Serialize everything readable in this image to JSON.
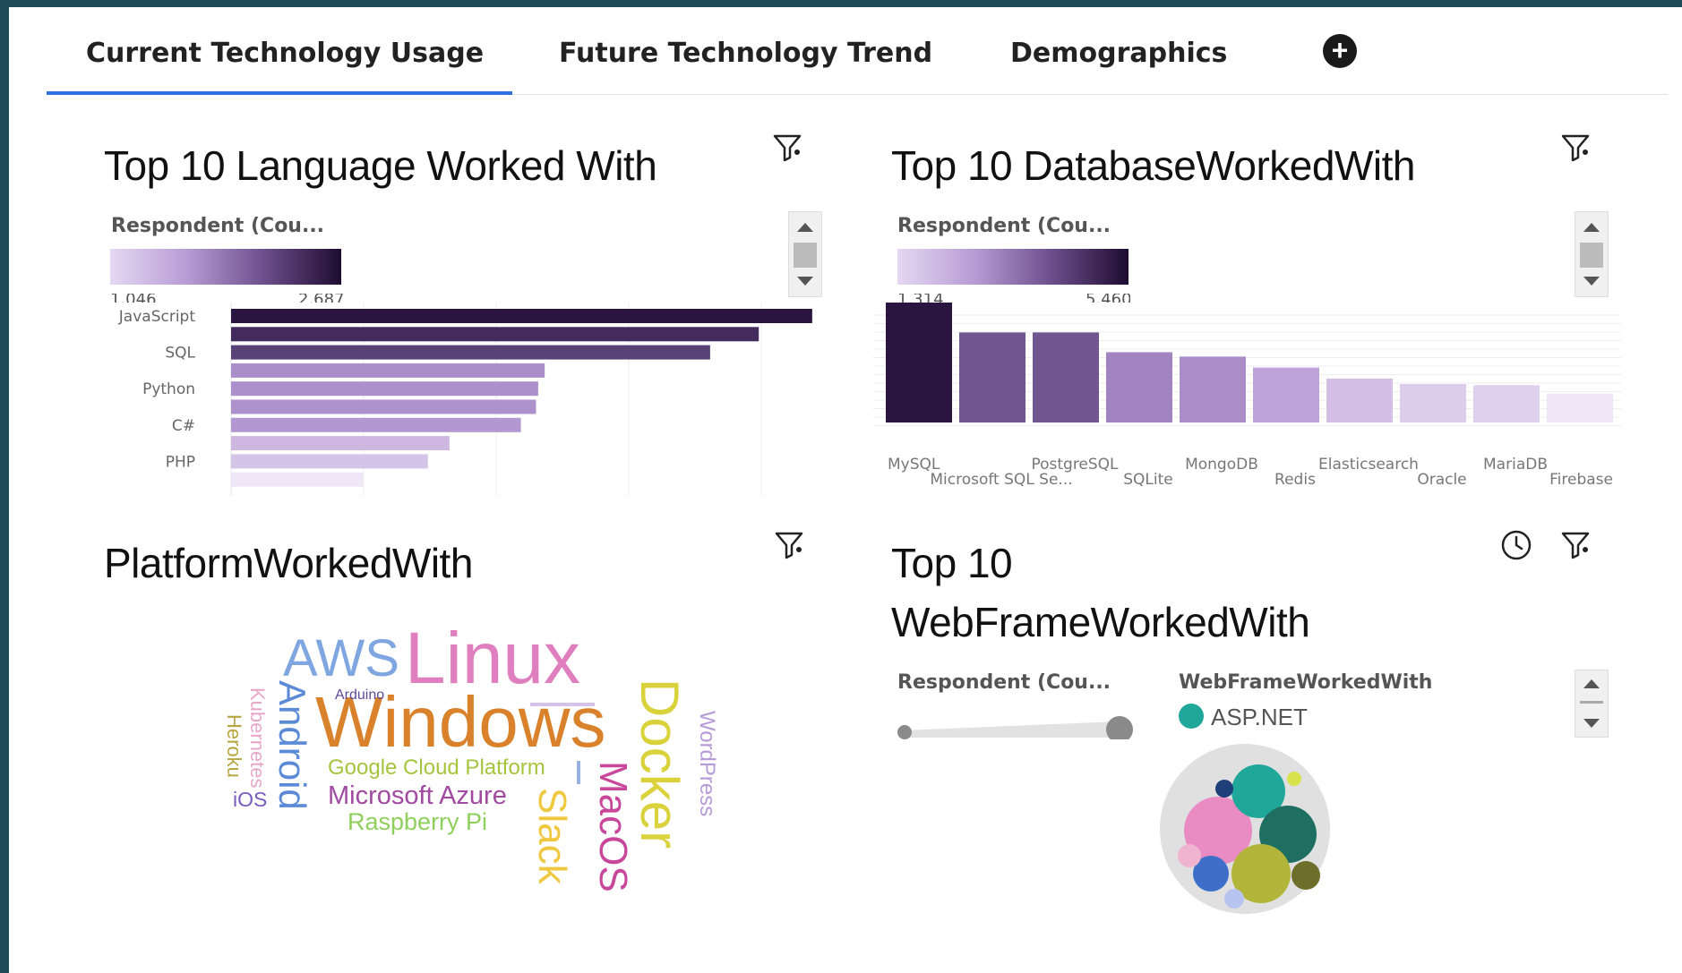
{
  "tabs": [
    {
      "label": "Current Technology Usage",
      "active": true
    },
    {
      "label": "Future Technology Trend",
      "active": false
    },
    {
      "label": "Demographics",
      "active": false
    }
  ],
  "add_tab_icon": "plus-circle-icon",
  "panels": {
    "languages": {
      "title": "Top 10 Language Worked With",
      "legend_label": "Respondent (Cou...",
      "legend_min": "1,046",
      "legend_max": "2,687"
    },
    "databases": {
      "title": "Top 10 DatabaseWorkedWith",
      "legend_label": "Respondent (Cou...",
      "legend_min": "1,314",
      "legend_max": "5,460"
    },
    "platforms": {
      "title": "PlatformWorkedWith"
    },
    "webframes": {
      "title_line1": "Top 10",
      "title_line2": "WebFrameWorkedWith",
      "legend_label": "Respondent (Cou...",
      "legend2_label": "WebFrameWorkedWith",
      "legend2_item": "ASP.NET"
    }
  },
  "colors": {
    "accent_tab": "#2f6fe0",
    "purple_dark": "#2a1540",
    "purple_light": "#e9dff5"
  },
  "chart_data": [
    {
      "type": "bar",
      "orientation": "horizontal",
      "title": "Top 10 Language Worked With",
      "visible_tick_labels": [
        "JavaScript",
        "SQL",
        "Python",
        "C#",
        "PHP"
      ],
      "values": [
        2687,
        2440,
        2215,
        1450,
        1420,
        1410,
        1340,
        1010,
        910,
        610
      ]
    },
    {
      "type": "bar",
      "title": "Top 10 DatabaseWorkedWith",
      "categories": [
        "MySQL",
        "Microsoft SQL Se...",
        "PostgreSQL",
        "SQLite",
        "MongoDB",
        "Redis",
        "Elasticsearch",
        "Oracle",
        "MariaDB",
        "Firebase"
      ],
      "values": [
        5460,
        4100,
        4100,
        3200,
        3000,
        2500,
        2000,
        1750,
        1700,
        1314
      ]
    },
    {
      "type": "wordcloud",
      "title": "PlatformWorkedWith",
      "words": [
        {
          "text": "Windows",
          "color": "#d9822b"
        },
        {
          "text": "Linux",
          "color": "#e07fbf"
        },
        {
          "text": "AWS",
          "color": "#7fa6e0"
        },
        {
          "text": "Docker",
          "color": "#d9d23a"
        },
        {
          "text": "Android",
          "color": "#5b8ad6"
        },
        {
          "text": "MacOS",
          "color": "#c8479a"
        },
        {
          "text": "Slack",
          "color": "#f0c840"
        },
        {
          "text": "Google Cloud Platform",
          "color": "#a6c43d"
        },
        {
          "text": "Microsoft Azure",
          "color": "#a04aa0"
        },
        {
          "text": "Raspberry Pi",
          "color": "#8fcf5c"
        },
        {
          "text": "WordPress",
          "color": "#b79ad8"
        },
        {
          "text": "Kubernetes",
          "color": "#e8a7c8"
        },
        {
          "text": "Heroku",
          "color": "#b7a642"
        },
        {
          "text": "iOS",
          "color": "#7a5cbf"
        },
        {
          "text": "Arduino",
          "color": "#5a4a9a"
        }
      ]
    },
    {
      "type": "bubble",
      "title": "Top 10 WebFrameWorkedWith",
      "legend": [
        "ASP.NET"
      ]
    }
  ]
}
